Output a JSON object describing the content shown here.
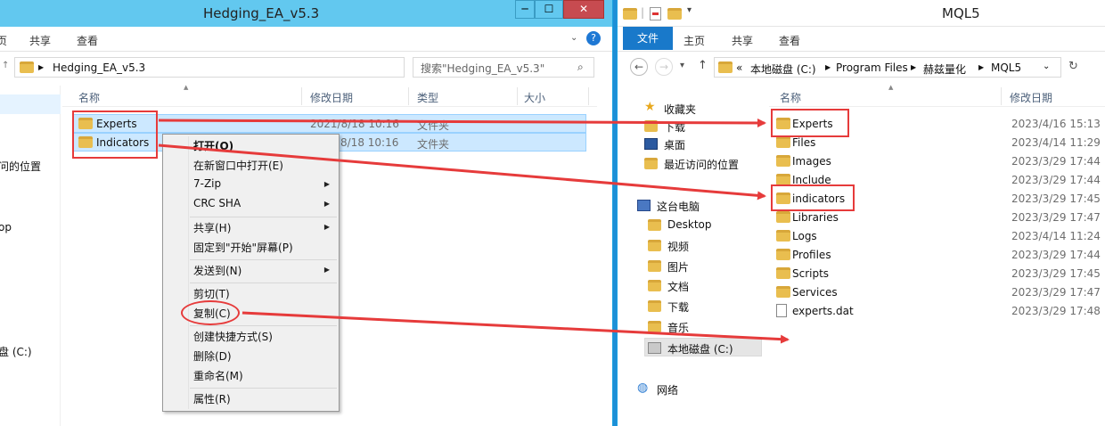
{
  "left_window": {
    "title": "Hedging_EA_v5.3",
    "ribbon": [
      "页",
      "共享",
      "查看"
    ],
    "path": [
      "Hedging_EA_v5.3"
    ],
    "search_placeholder": "搜索\"Hedging_EA_v5.3\"",
    "columns": [
      "名称",
      "修改日期",
      "类型",
      "大小"
    ],
    "nav_items": [
      "问的位置",
      "op",
      "盘 (C:)"
    ],
    "files": [
      {
        "name": "Experts",
        "date": "2021/8/18 10:16",
        "type": "文件夹"
      },
      {
        "name": "Indicators",
        "date": "8/18 10:16",
        "type": "文件夹"
      }
    ]
  },
  "right_window": {
    "title": "MQL5",
    "ribbon": [
      "文件",
      "主页",
      "共享",
      "查看"
    ],
    "path": [
      "«",
      "本地磁盘 (C:)",
      "Program Files",
      "赫兹量化",
      "MQL5"
    ],
    "columns": [
      "名称",
      "修改日期"
    ],
    "nav_items": [
      {
        "label": "收藏夹",
        "icon": "star-icon"
      },
      {
        "label": "下载",
        "icon": "download-folder-icon"
      },
      {
        "label": "桌面",
        "icon": "desktop-icon"
      },
      {
        "label": "最近访问的位置",
        "icon": "recent-places-icon"
      },
      {
        "label": "这台电脑",
        "icon": "computer-icon"
      },
      {
        "label": "Desktop",
        "icon": "folder-icon"
      },
      {
        "label": "视频",
        "icon": "video-folder-icon"
      },
      {
        "label": "图片",
        "icon": "pictures-folder-icon"
      },
      {
        "label": "文档",
        "icon": "documents-folder-icon"
      },
      {
        "label": "下载",
        "icon": "download-folder-icon"
      },
      {
        "label": "音乐",
        "icon": "music-folder-icon"
      },
      {
        "label": "本地磁盘 (C:)",
        "icon": "drive-icon"
      },
      {
        "label": "网络",
        "icon": "network-icon"
      }
    ],
    "files": [
      {
        "name": "Experts",
        "date": "2023/4/16 15:13",
        "icon": "folder"
      },
      {
        "name": "Files",
        "date": "2023/4/14 11:29",
        "icon": "folder"
      },
      {
        "name": "Images",
        "date": "2023/3/29 17:44",
        "icon": "folder"
      },
      {
        "name": "Include",
        "date": "2023/3/29 17:44",
        "icon": "folder"
      },
      {
        "name": "indicators",
        "date": "2023/3/29 17:45",
        "icon": "folder"
      },
      {
        "name": "Libraries",
        "date": "2023/3/29 17:47",
        "icon": "folder"
      },
      {
        "name": "Logs",
        "date": "2023/4/14 11:24",
        "icon": "folder"
      },
      {
        "name": "Profiles",
        "date": "2023/3/29 17:44",
        "icon": "folder"
      },
      {
        "name": "Scripts",
        "date": "2023/3/29 17:45",
        "icon": "folder"
      },
      {
        "name": "Services",
        "date": "2023/3/29 17:47",
        "icon": "folder"
      },
      {
        "name": "experts.dat",
        "date": "2023/3/29 17:48",
        "icon": "file"
      }
    ]
  },
  "context_menu": {
    "items": [
      {
        "label": "打开(O)",
        "bold": true
      },
      {
        "label": "在新窗口中打开(E)"
      },
      {
        "label": "7-Zip",
        "submenu": true
      },
      {
        "label": "CRC SHA",
        "submenu": true
      },
      {
        "label": "共享(H)",
        "submenu": true
      },
      {
        "label": "固定到\"开始\"屏幕(P)"
      },
      {
        "label": "发送到(N)",
        "submenu": true
      },
      {
        "label": "剪切(T)"
      },
      {
        "label": "复制(C)"
      },
      {
        "label": "创建快捷方式(S)"
      },
      {
        "label": "删除(D)"
      },
      {
        "label": "重命名(M)"
      },
      {
        "label": "属性(R)"
      }
    ]
  },
  "window_buttons": {
    "minimize": "─",
    "maximize": "☐",
    "close": "✕"
  },
  "colors": {
    "annotation": "#e63b3b",
    "selection": "#cce8ff",
    "title_bar": "#62c8ef",
    "file_tab": "#1979ca"
  }
}
